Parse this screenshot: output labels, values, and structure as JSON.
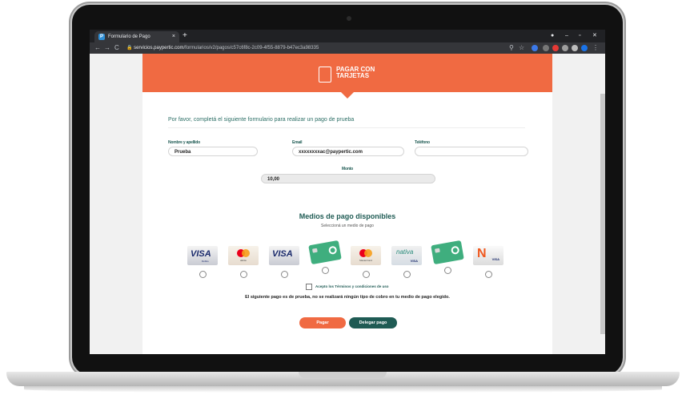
{
  "browser": {
    "tab_title": "Formulario de Pago",
    "tab_close": "×",
    "new_tab": "+",
    "url_host": "servicios.paypertic.com",
    "url_path": "/formularios/v2/pagos/c57c6f8c-2c09-4f55-8879-b47ec3a98335",
    "nav_back": "←",
    "nav_forward": "→",
    "nav_reload": "C"
  },
  "banner": {
    "title_line1": "PAGAR CON",
    "title_line2": "TARJETAS"
  },
  "form": {
    "intro": "Por favor, completá el siguiente formulario para realizar un pago de prueba",
    "name_label": "Nombre y apellido",
    "name_value": "Prueba",
    "email_label": "Email",
    "email_value": "xxxxxxxxac@paypertic.com",
    "phone_label": "Teléfono",
    "phone_value": "",
    "amount_label": "Monto",
    "amount_value": "10,00"
  },
  "payment": {
    "title": "Medios de pago disponibles",
    "subtitle": "Seleccioná un medio de pago",
    "methods": [
      {
        "visa": "VISA",
        "sub": "Débito"
      },
      {
        "sub": "débito"
      },
      {
        "visa": "VISA"
      },
      {},
      {
        "sub": "MasterCard"
      },
      {
        "name": "nativa",
        "brand": "VISA"
      },
      {},
      {
        "name": "N",
        "brand": "VISA"
      }
    ]
  },
  "terms": {
    "text": "Acepto los Términos y condiciones de uso",
    "disclaimer": "El siguiente pago es de prueba, no se realizará ningún tipo de cobro en tu medio de pago elegido."
  },
  "buttons": {
    "pay": "Pagar",
    "delegate": "Delegar pago"
  },
  "colors": {
    "brand_orange": "#f06a42",
    "brand_green": "#1f5b54"
  }
}
